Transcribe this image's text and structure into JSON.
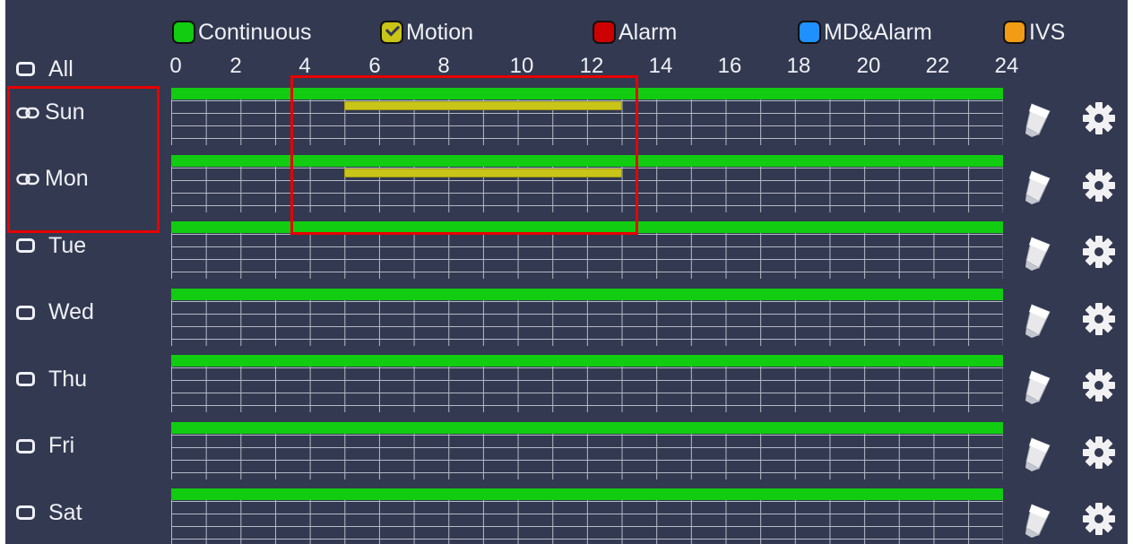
{
  "legend": [
    {
      "label": "Continuous",
      "color": "#11cc11",
      "checked": false
    },
    {
      "label": "Motion",
      "color": "#c9c418",
      "checked": true
    },
    {
      "label": "Alarm",
      "color": "#cc0000",
      "checked": false
    },
    {
      "label": "MD&Alarm",
      "color": "#1e90ff",
      "checked": false
    },
    {
      "label": "IVS",
      "color": "#f29b14",
      "checked": false
    }
  ],
  "all_label": "All",
  "hour_ticks": [
    "0",
    "2",
    "4",
    "6",
    "8",
    "10",
    "12",
    "14",
    "16",
    "18",
    "20",
    "22",
    "24"
  ],
  "days": [
    {
      "label": "Sun",
      "linked": true,
      "continuous": [
        0,
        24
      ],
      "motion": [
        5,
        13
      ]
    },
    {
      "label": "Mon",
      "linked": true,
      "continuous": [
        0,
        24
      ],
      "motion": [
        5,
        13
      ]
    },
    {
      "label": "Tue",
      "linked": false,
      "continuous": [
        0,
        24
      ],
      "motion": null
    },
    {
      "label": "Wed",
      "linked": false,
      "continuous": [
        0,
        24
      ],
      "motion": null
    },
    {
      "label": "Thu",
      "linked": false,
      "continuous": [
        0,
        24
      ],
      "motion": null
    },
    {
      "label": "Fri",
      "linked": false,
      "continuous": [
        0,
        24
      ],
      "motion": null
    },
    {
      "label": "Sat",
      "linked": false,
      "continuous": [
        0,
        24
      ],
      "motion": null
    }
  ]
}
